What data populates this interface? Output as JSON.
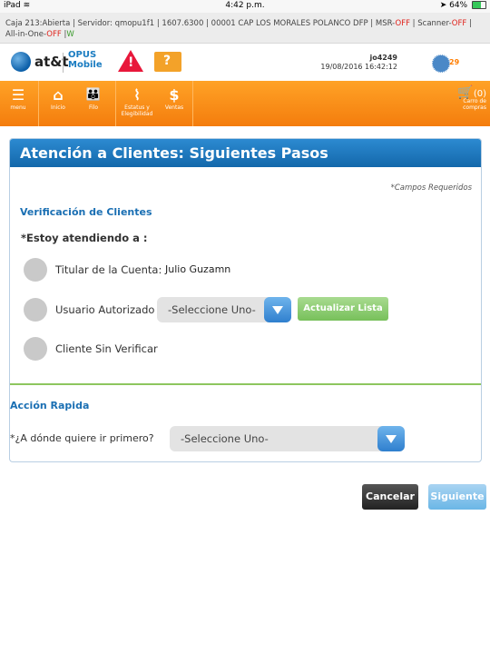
{
  "status_bar": {
    "device": "iPad",
    "wifi_icon": "wifi-icon",
    "time": "4:42 p.m.",
    "battery": "64%",
    "battery_level": 0.64
  },
  "info_strip": {
    "caja": "Caja 213:Abierta",
    "servidor": "Servidor: qmopu1f1",
    "version": "1607.6300",
    "store": "00001 CAP LOS MORALES POLANCO DFP",
    "msr_label": "MSR-",
    "msr_state": "OFF",
    "scanner_label": "Scanner-",
    "scanner_state": "OFF",
    "allinone_label": "All-in-One-",
    "allinone_state": "OFF",
    "w_label": "W"
  },
  "brand": {
    "logo_text": "at&t",
    "app_name_line1": "OPUS",
    "app_name_line2": "Mobile",
    "user_id": "jo4249",
    "datetime": "19/08/2016 16:42:12",
    "notification_count": "29"
  },
  "nav": {
    "items": [
      {
        "label": "menu",
        "icon": "menu-icon",
        "glyph": "☰"
      },
      {
        "label": "Inicio",
        "icon": "home-icon",
        "glyph": "⌂"
      },
      {
        "label": "Filo",
        "icon": "people-icon",
        "glyph": "👪"
      },
      {
        "label": "Estatus y Elegibilidad",
        "icon": "pulse-icon",
        "glyph": "⌇"
      },
      {
        "label": "Ventas",
        "icon": "dollar-icon",
        "glyph": "$"
      }
    ],
    "cart_count": "(0)",
    "cart_label_line1": "Carro de",
    "cart_label_line2": "compras",
    "cart_icon": "cart-icon"
  },
  "panel": {
    "title": "Atención a Clientes: Siguientes Pasos",
    "required_note": "*Campos Requeridos",
    "verification_title": "Verificación de Clientes",
    "question": "*Estoy atendiendo a :",
    "options": {
      "titular_label": "Titular de la Cuenta:",
      "titular_value": "Julio Guzamn",
      "usuario_label": "Usuario Autorizado",
      "usuario_select": "-Seleccione Uno-",
      "refresh_button": "Actualizar Lista",
      "sin_verificar_label": "Cliente Sin Verificar"
    },
    "quick_title": "Acción Rapida",
    "quick_question": "*¿A dónde quiere ir primero?",
    "quick_select": "-Seleccione Uno-"
  },
  "actions": {
    "cancel": "Cancelar",
    "next": "Siguiente"
  },
  "colors": {
    "nav_orange": "#f7901e",
    "header_blue": "#1e79c0",
    "accent_green": "#8dc65e",
    "off_red": "#e0221b"
  }
}
